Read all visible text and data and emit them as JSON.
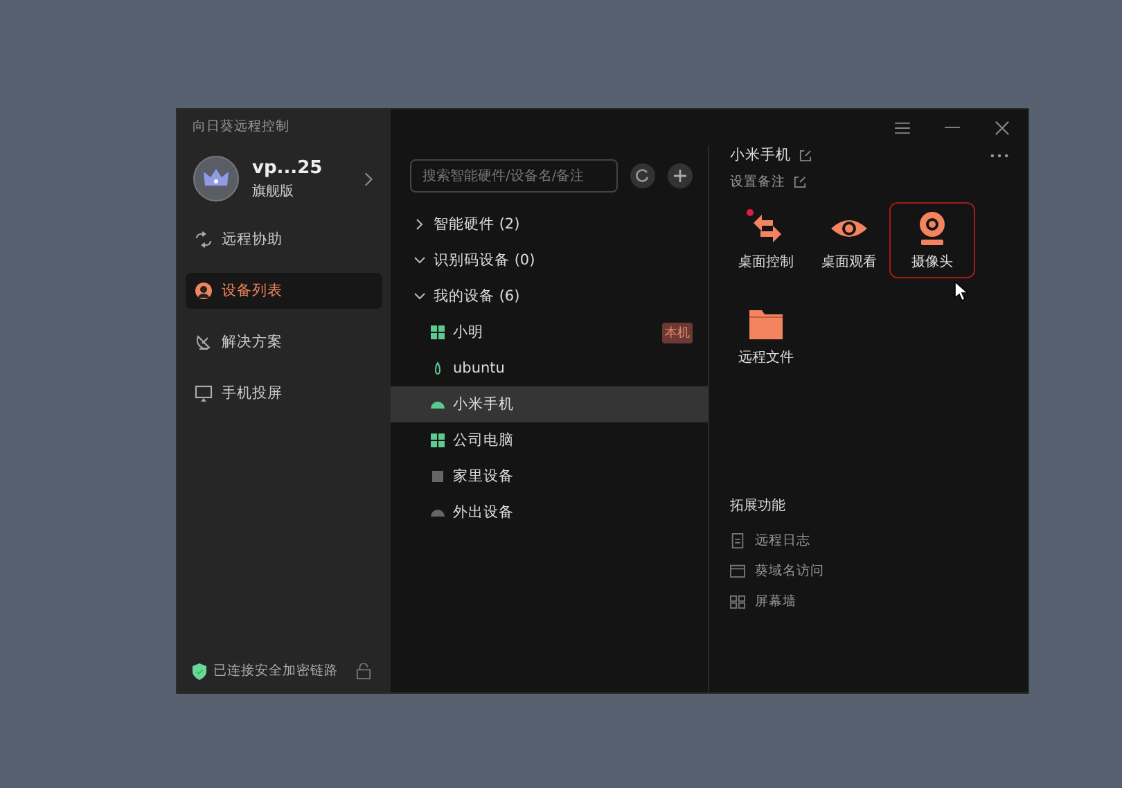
{
  "window": {
    "title": "向日葵远程控制"
  },
  "account": {
    "name": "vp...25",
    "plan": "旗舰版"
  },
  "nav": [
    {
      "label": "远程协助",
      "kind": "assist",
      "selected": false
    },
    {
      "label": "设备列表",
      "kind": "devices",
      "selected": true
    },
    {
      "label": "解决方案",
      "kind": "solution",
      "selected": false
    },
    {
      "label": "手机投屏",
      "kind": "cast",
      "selected": false
    }
  ],
  "status": {
    "text": "已连接安全加密链路"
  },
  "search": {
    "placeholder": "搜索智能硬件/设备名/备注"
  },
  "groups": [
    {
      "label": "智能硬件 (2)",
      "expanded": false
    },
    {
      "label": "识别码设备 (0)",
      "expanded": true
    },
    {
      "label": "我的设备 (6)",
      "expanded": true,
      "children": [
        {
          "name": "小明",
          "kind": "windows",
          "selected": false,
          "tag": "本机"
        },
        {
          "name": "ubuntu",
          "kind": "linux",
          "selected": false
        },
        {
          "name": "小米手机",
          "kind": "android",
          "selected": true
        },
        {
          "name": "公司电脑",
          "kind": "windows",
          "selected": false
        },
        {
          "name": "家里设备",
          "kind": "offline",
          "selected": false
        },
        {
          "name": "外出设备",
          "kind": "android-offline",
          "selected": false
        }
      ]
    }
  ],
  "detail": {
    "device_name": "小米手机",
    "note": "设置备注",
    "functions": [
      {
        "label": "桌面控制",
        "kind": "control",
        "selected": false,
        "dot": true
      },
      {
        "label": "桌面观看",
        "kind": "view",
        "selected": false,
        "dot": false
      },
      {
        "label": "摄像头",
        "kind": "camera",
        "selected": true,
        "dot": false
      },
      {
        "label": "远程文件",
        "kind": "files",
        "selected": false,
        "dot": false
      }
    ],
    "extensions_title": "拓展功能",
    "extensions": [
      {
        "label": "远程日志",
        "kind": "log"
      },
      {
        "label": "葵域名访问",
        "kind": "domain"
      },
      {
        "label": "屏幕墙",
        "kind": "wall"
      }
    ]
  }
}
